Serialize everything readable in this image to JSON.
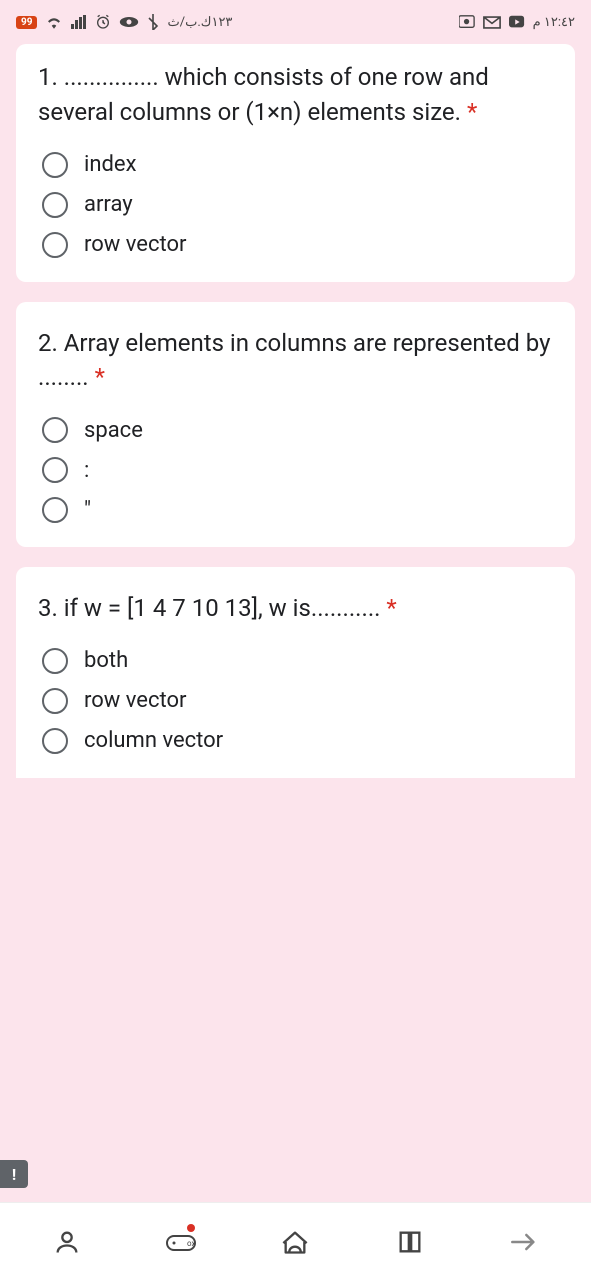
{
  "status": {
    "battery": "99",
    "network_text": "١٢٣ك.ب/ث",
    "time": "١٢:٤٢ م"
  },
  "questions": [
    {
      "text": "1. ............... which consists of one row and several columns or (1×n) elements size.",
      "required": "*",
      "options": [
        "index",
        "array",
        "row vector"
      ]
    },
    {
      "text": "2. Array elements in columns are represented by ........",
      "required": "*",
      "options": [
        "space",
        ":",
        "\""
      ]
    },
    {
      "text": "3. if w = [1 4 7 10 13], w is...........",
      "required": "*",
      "options": [
        "both",
        "row vector",
        "column vector"
      ]
    }
  ],
  "report_icon": "!"
}
